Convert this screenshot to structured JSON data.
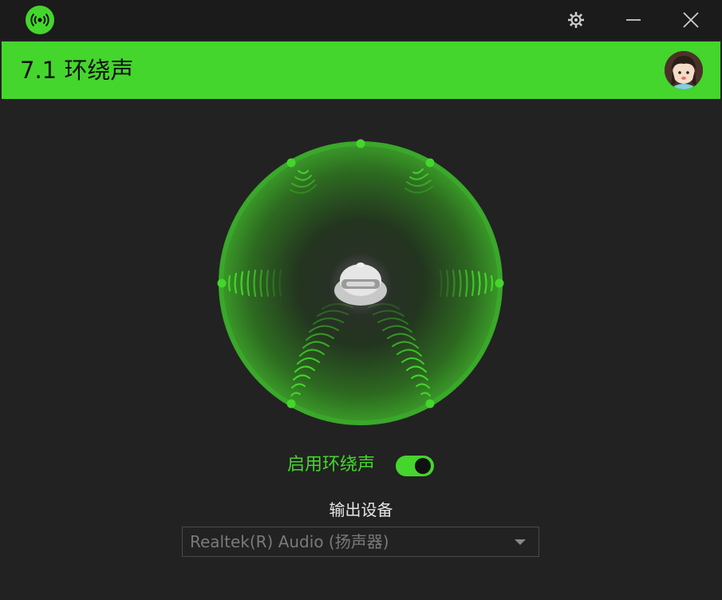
{
  "window": {
    "icons": {
      "logo": "broadcast-icon",
      "settings": "gear-icon",
      "minimize": "minimize-icon",
      "close": "close-icon"
    }
  },
  "header": {
    "title": "7.1 环绕声",
    "avatar": "user-avatar"
  },
  "surround": {
    "center": "headphones-listener-icon",
    "speakers": [
      "front-left",
      "center",
      "front-right",
      "side-left",
      "side-right",
      "rear-left",
      "rear-right"
    ]
  },
  "toggle": {
    "label": "启用环绕声",
    "enabled": true
  },
  "output": {
    "label": "输出设备",
    "selected": "Realtek(R) Audio (扬声器)"
  },
  "colors": {
    "accent": "#44d62c",
    "background": "#222222",
    "titlebar": "#1b1b1b"
  }
}
